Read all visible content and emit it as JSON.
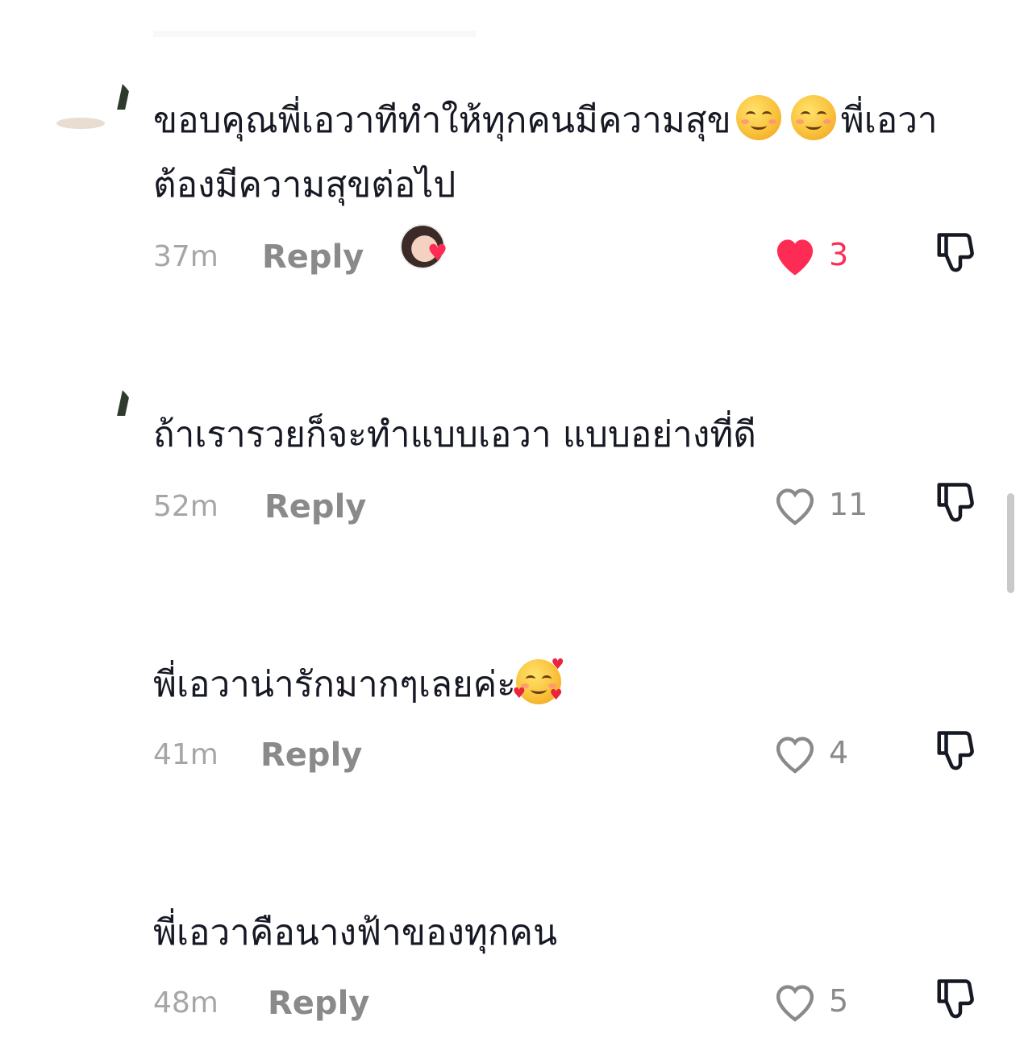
{
  "reply_label": "Reply",
  "comments": [
    {
      "text_parts": [
        "ขอบคุณพี่เอวาทีทำให้ทุกคนมีความสุข",
        "พี่เอวาต้องมีความสุขต่อไป"
      ],
      "emojis": [
        "smiling-face-emoji",
        "smiling-face-emoji"
      ],
      "time": "37m",
      "likes": "3",
      "liked": true,
      "creator_liked": true
    },
    {
      "text": "ถ้าเรารวยก็จะทำแบบเอวา แบบอย่างที่ดี",
      "time": "52m",
      "likes": "11",
      "liked": false
    },
    {
      "text": "พี่เอวาน่ารักมากๆเลยค่ะ",
      "emojis": [
        "smiling-face-with-hearts-emoji"
      ],
      "time": "41m",
      "likes": "4",
      "liked": false
    },
    {
      "text": "พี่เอวาคือนางฟ้าของทุกคน",
      "time": "48m",
      "likes": "5",
      "liked": false
    }
  ],
  "colors": {
    "text": "#161823",
    "meta": "#a6a6a6",
    "like_active": "#fe2c55"
  }
}
